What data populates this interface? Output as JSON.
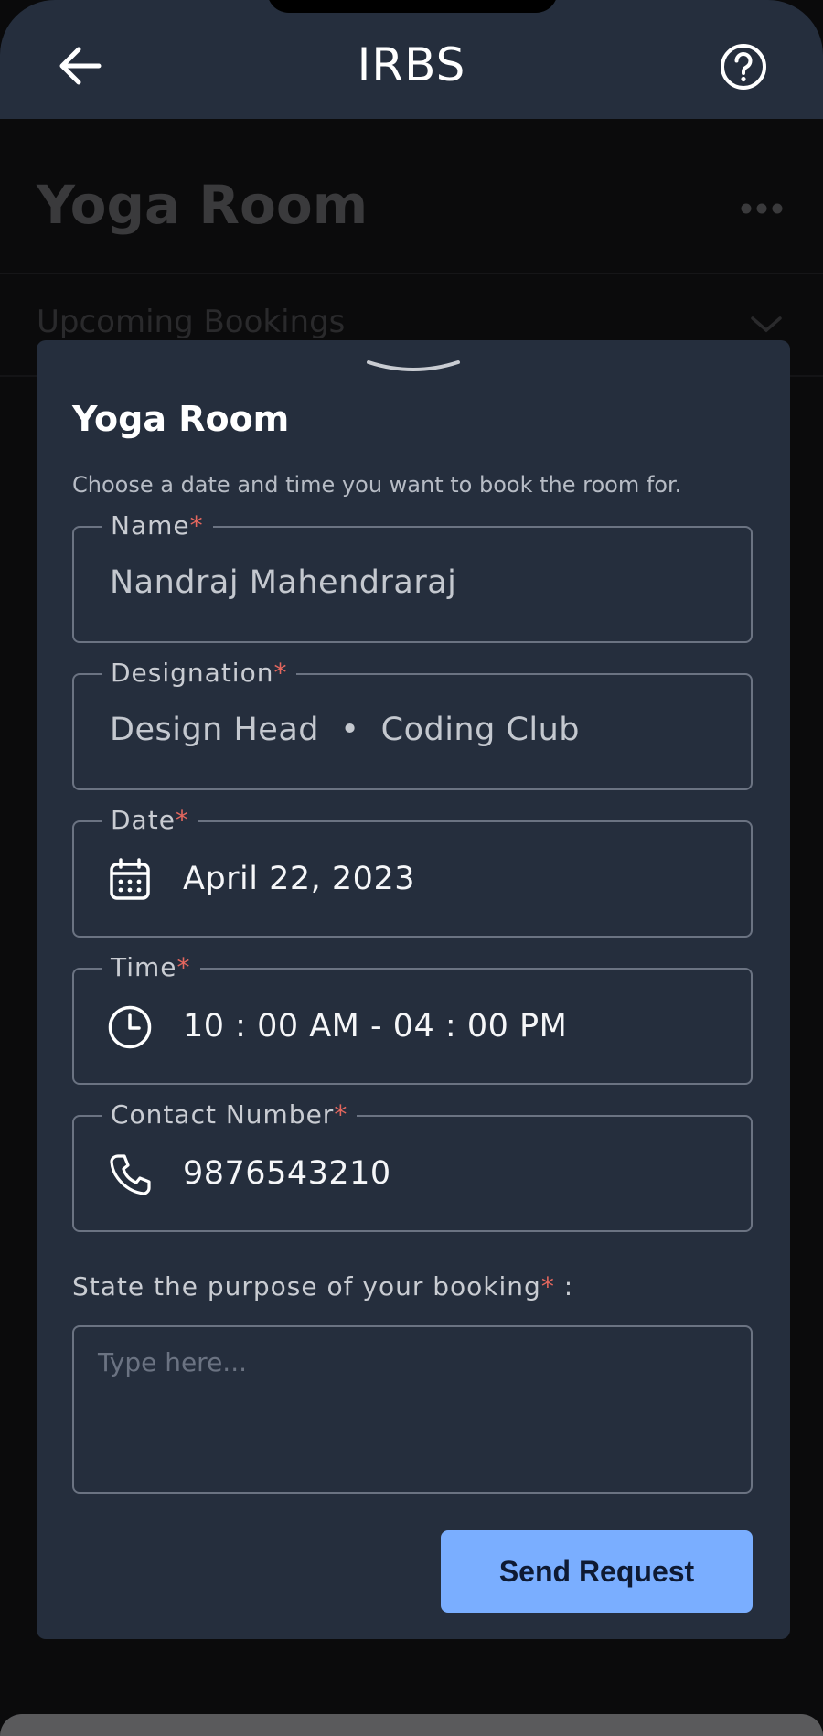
{
  "appbar": {
    "title": "IRBS",
    "back_icon": "arrow-left-icon",
    "help_icon": "question-circle-icon"
  },
  "background": {
    "room_title": "Yoga Room",
    "section": "Upcoming Bookings"
  },
  "sheet": {
    "title": "Yoga Room",
    "subtitle": "Choose a date and time you want to book the room for.",
    "fields": {
      "name": {
        "label": "Name",
        "required_mark": "*",
        "value": "Nandraj Mahendraraj"
      },
      "designation": {
        "label": "Designation",
        "required_mark": "*",
        "value": "Design Head  •  Coding Club"
      },
      "date": {
        "label": "Date",
        "required_mark": "*",
        "value": "April 22, 2023",
        "icon": "calendar-icon"
      },
      "time": {
        "label": "Time",
        "required_mark": "*",
        "value": "10 : 00 AM - 04 : 00 PM",
        "icon": "clock-icon"
      },
      "contact": {
        "label": "Contact Number",
        "required_mark": "*",
        "value": "9876543210",
        "icon": "phone-icon"
      }
    },
    "purpose": {
      "label": "State the purpose of your booking",
      "required_mark": "*",
      "suffix": " :",
      "placeholder": "Type here..."
    },
    "send_button": "Send Request"
  },
  "colors": {
    "accent": "#7aaeff",
    "sheet": "#252e3d",
    "required": "#e4675e"
  }
}
